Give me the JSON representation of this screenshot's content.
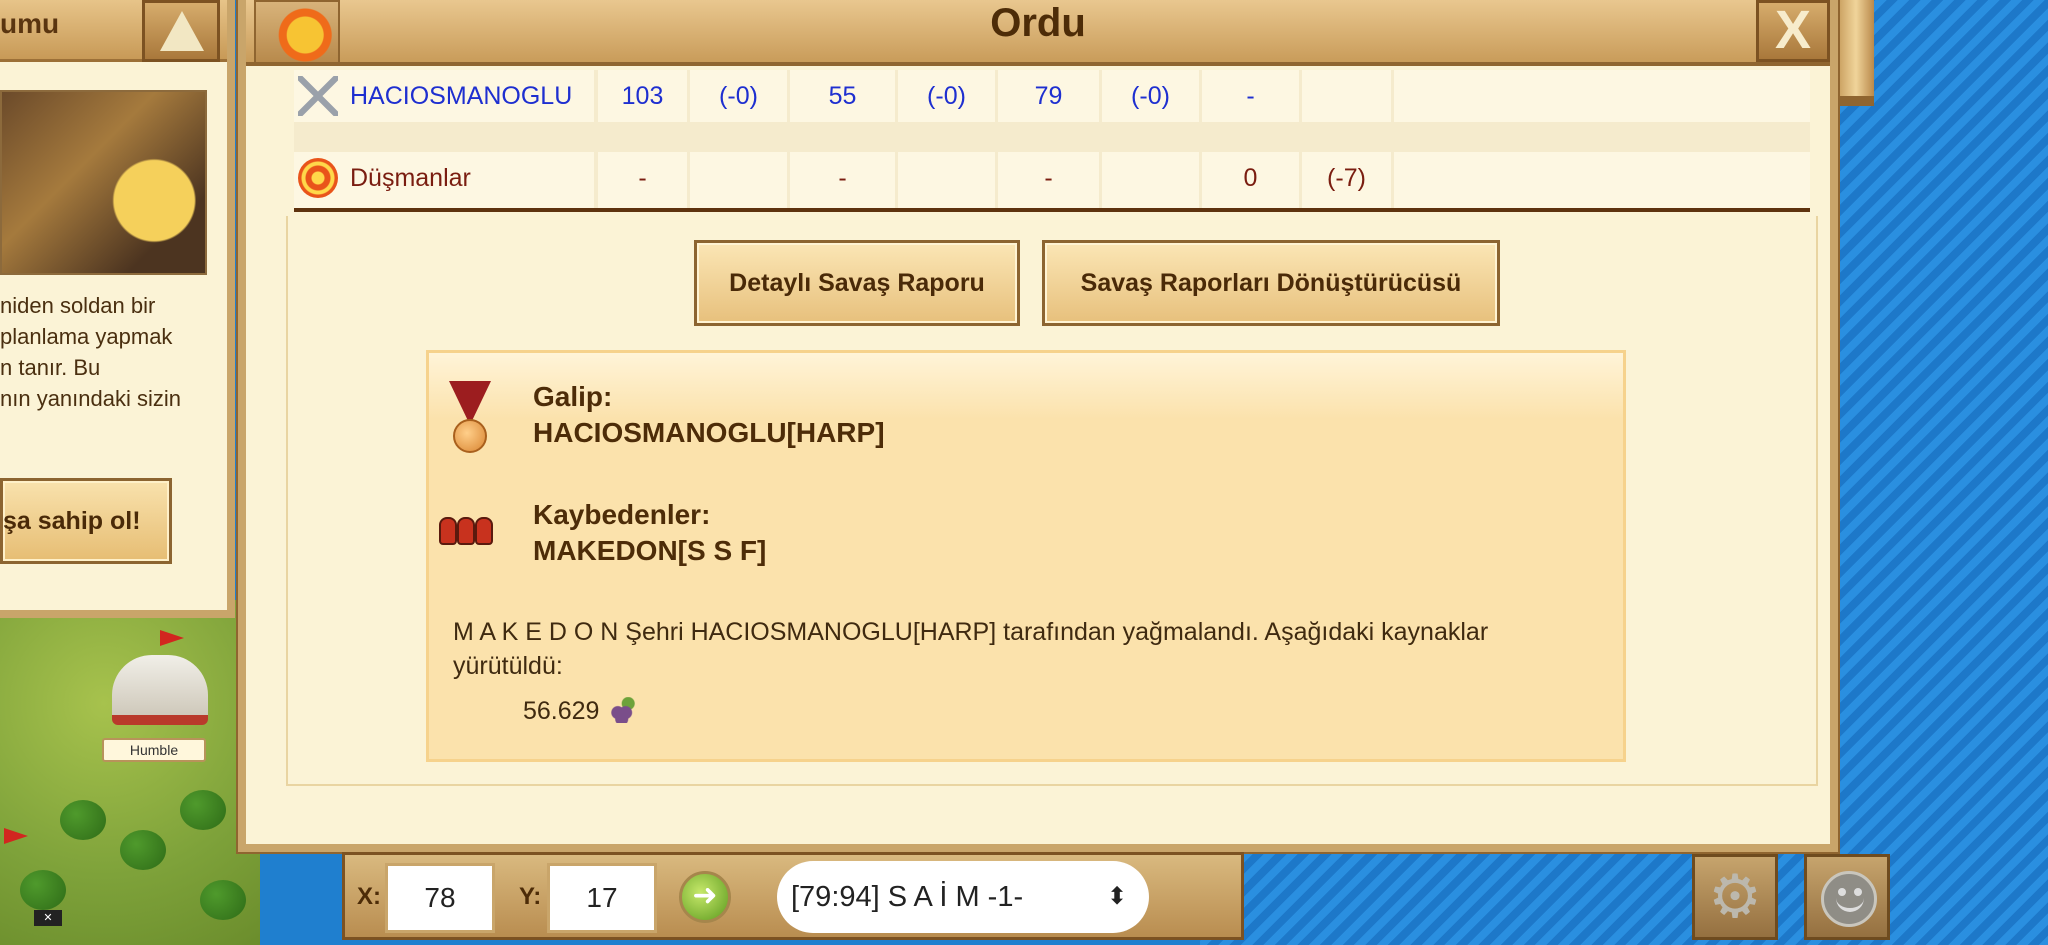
{
  "left_panel": {
    "header_title": "umu",
    "text_lines": [
      "niden soldan bir",
      "planlama yapmak",
      "n tanır. Bu",
      "nın yanındaki sizin"
    ],
    "cta_label": "şa sahip ol!"
  },
  "map": {
    "city_label": "Humble"
  },
  "dialog": {
    "title": "Ordu",
    "close_label": "X"
  },
  "battle_table": {
    "rows": [
      {
        "name": "HACIOSMANOGLU",
        "icon": "swords-icon",
        "cells": [
          "103",
          "(-0)",
          "55",
          "(-0)",
          "79",
          "(-0)",
          "-",
          "",
          ""
        ]
      },
      {
        "name": "Düşmanlar",
        "icon": "target-icon",
        "cells": [
          "-",
          "",
          "-",
          "",
          "-",
          "",
          "0",
          "(-7)",
          ""
        ]
      }
    ]
  },
  "actions": {
    "detail_report": "Detaylı Savaş Raporu",
    "report_converter": "Savaş Raporları Dönüştürücüsü"
  },
  "result": {
    "winner_label": "Galip:",
    "winner_name": "HACIOSMANOGLU[HARP]",
    "loser_label": "Kaybedenler:",
    "loser_name": "MAKEDON[S S F]",
    "summary": "M A K E D O N Şehri HACIOSMANOGLU[HARP] tarafından yağmalandı. Aşağıdaki kaynaklar yürütüldü:",
    "loot_amount": "56.629",
    "loot_icon": "grape-icon"
  },
  "coord_bar": {
    "x_label": "X:",
    "x_value": "78",
    "y_label": "Y:",
    "y_value": "17",
    "selected_city": "[79:94] S A İ M -1-"
  },
  "colors": {
    "panel_bg": "#fbf3d6",
    "frame": "#c9a56a",
    "own_text": "#1e2fd0",
    "enemy_text": "#7a1d10",
    "sea": "#1d78c9"
  }
}
